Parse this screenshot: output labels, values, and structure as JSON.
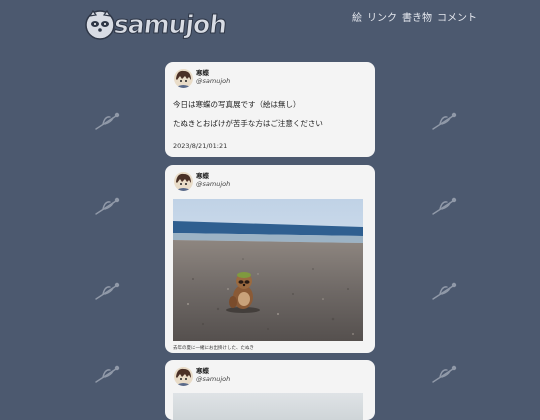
{
  "site": {
    "logo_text": "samujoh",
    "logo_icon": "raccoon-dog-face-icon",
    "background_mark_icon": "dragonfly-icon"
  },
  "nav": {
    "items": [
      {
        "label": "絵"
      },
      {
        "label": "リンク"
      },
      {
        "label": "書き物"
      },
      {
        "label": "コメント"
      }
    ]
  },
  "posts": [
    {
      "author_name": "寒蝶",
      "author_handle": "@samujoh",
      "lines": [
        "今日は寒蝶の写真展です（絵は無し）",
        "たぬきとおばけが苦手な方はご注意ください"
      ],
      "date": "2023/8/21/01:21"
    },
    {
      "author_name": "寒蝶",
      "author_handle": "@samujoh",
      "photo": "beach-tanuki-figurine-photo",
      "caption": "去年の夏に一緒にお出掛けした、たぬき"
    },
    {
      "author_name": "寒蝶",
      "author_handle": "@samujoh",
      "photo": "cropped-photo"
    }
  ],
  "colors": {
    "background": "#4c596f",
    "card": "#f4f4f4"
  }
}
